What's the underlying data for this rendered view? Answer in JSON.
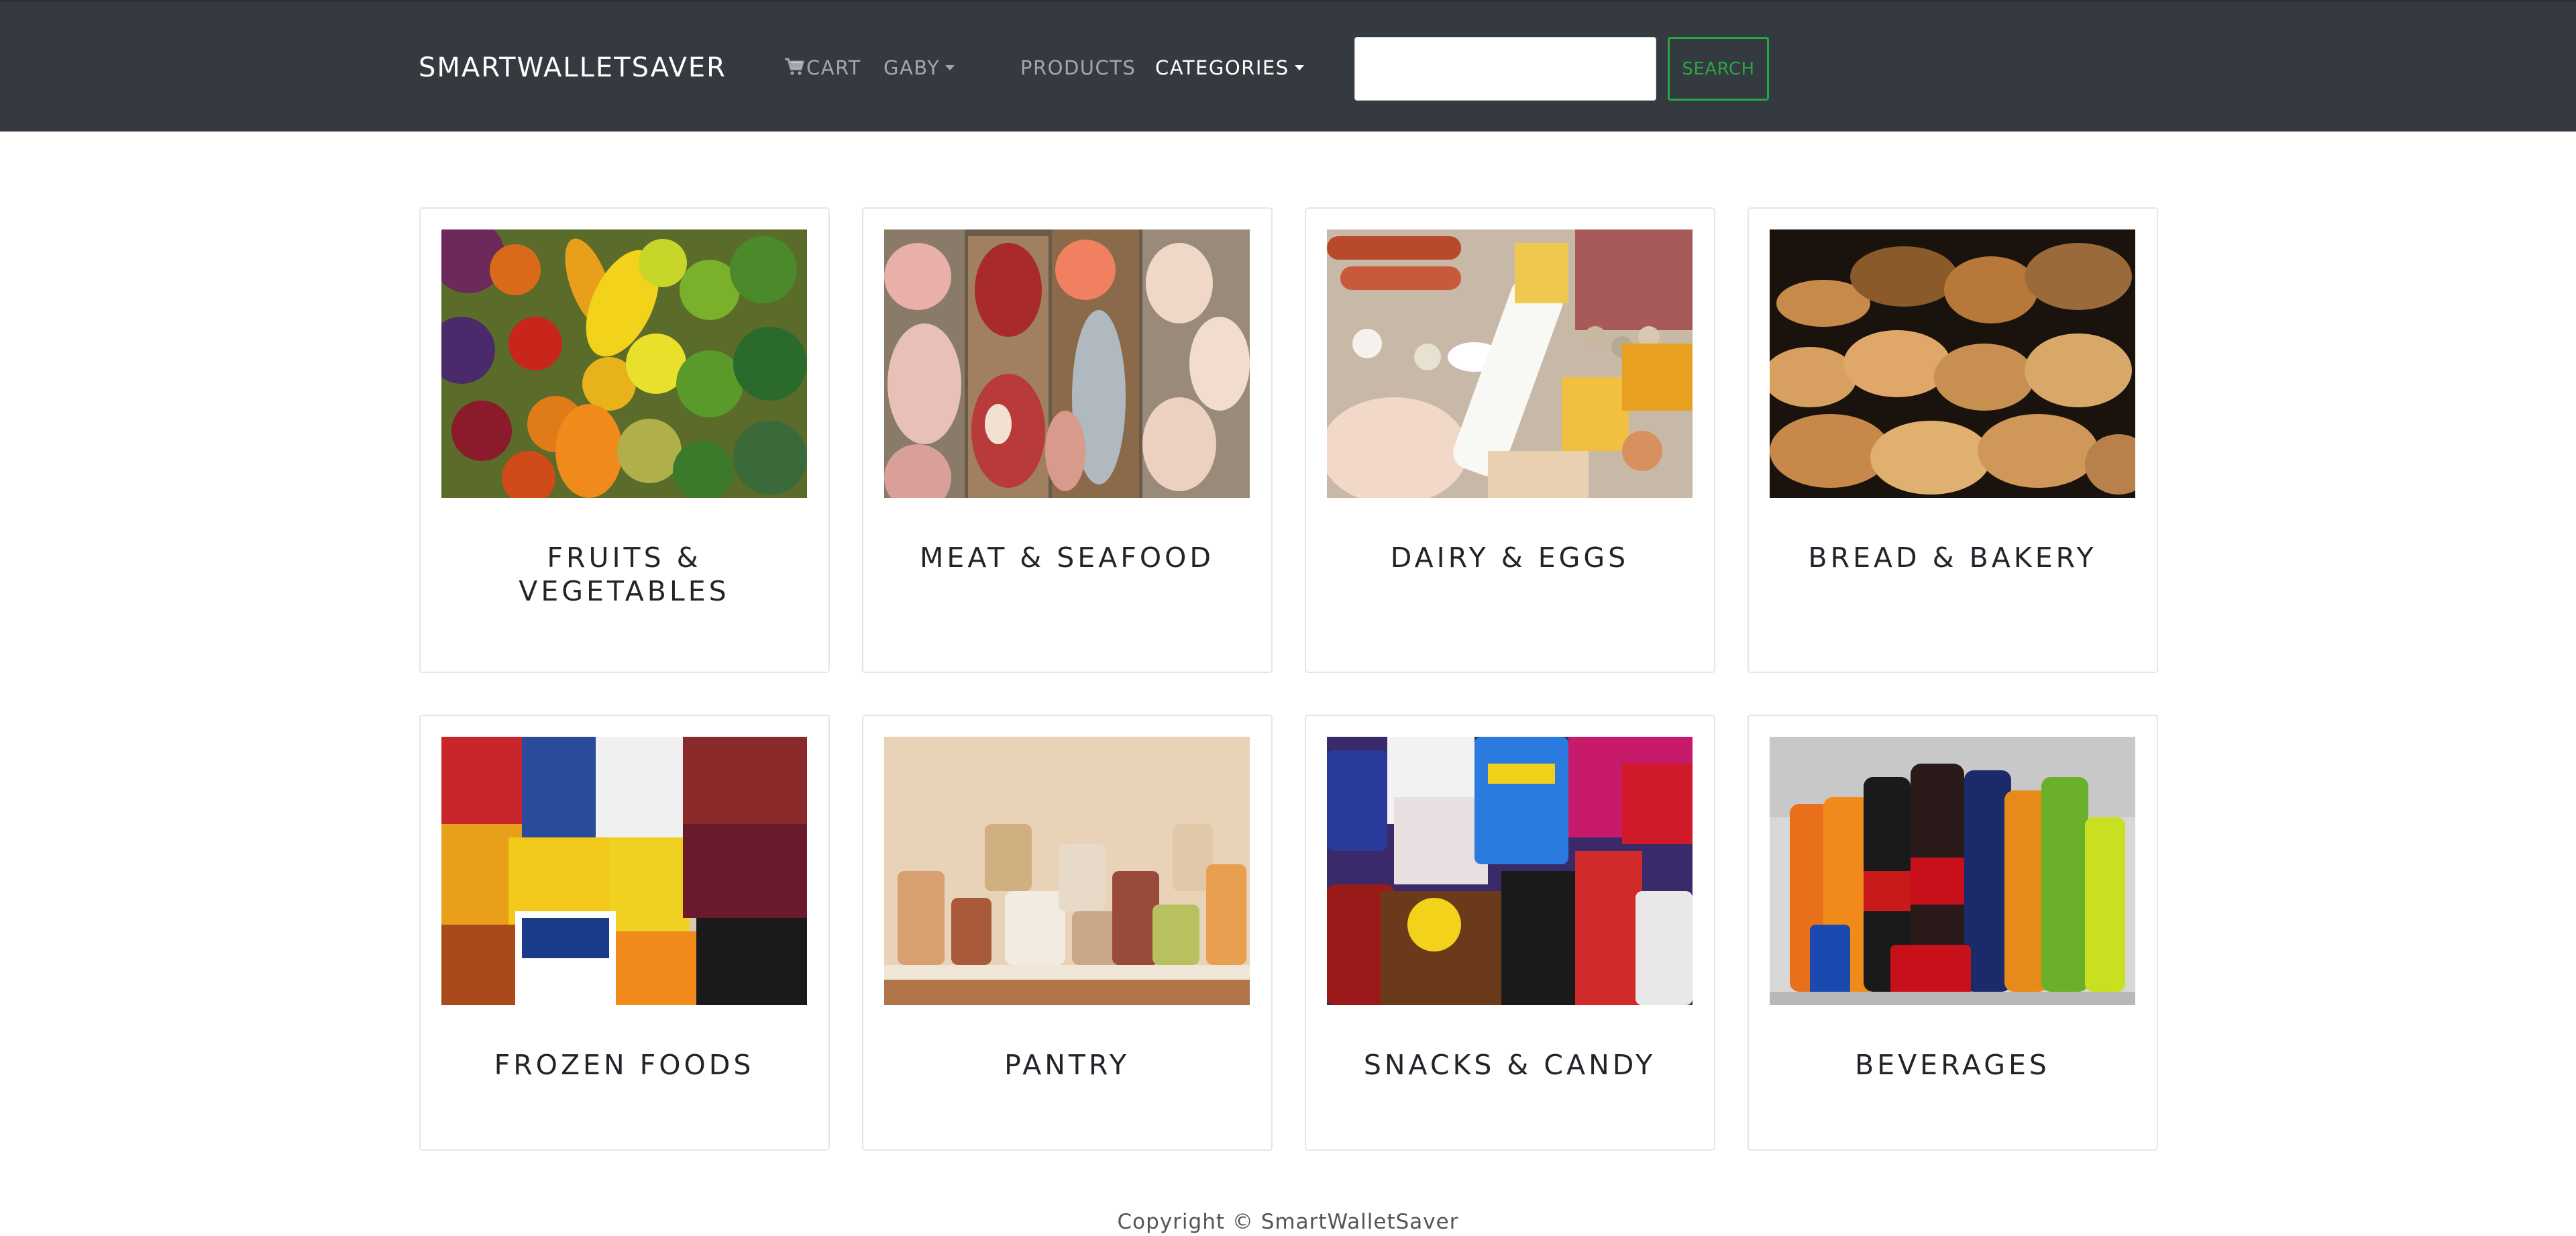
{
  "navbar": {
    "brand": "SMARTWALLETSAVER",
    "cart_label": "CART",
    "user_label": "GABY",
    "products_label": "PRODUCTS",
    "categories_label": "CATEGORIES",
    "search_placeholder": "",
    "search_value": "",
    "search_button": "SEARCH",
    "search_accent": "#28a745"
  },
  "categories": [
    {
      "title": "FRUITS & VEGETABLES",
      "image": "fruits-vegetables-photo"
    },
    {
      "title": "MEAT & SEAFOOD",
      "image": "meat-seafood-photo"
    },
    {
      "title": "DAIRY & EGGS",
      "image": "dairy-eggs-photo"
    },
    {
      "title": "BREAD & BAKERY",
      "image": "bread-bakery-photo"
    },
    {
      "title": "FROZEN FOODS",
      "image": "frozen-foods-photo"
    },
    {
      "title": "PANTRY",
      "image": "pantry-photo"
    },
    {
      "title": "SNACKS & CANDY",
      "image": "snacks-candy-photo"
    },
    {
      "title": "BEVERAGES",
      "image": "beverages-photo"
    }
  ],
  "footer": {
    "copyright": "Copyright © SmartWalletSaver"
  }
}
